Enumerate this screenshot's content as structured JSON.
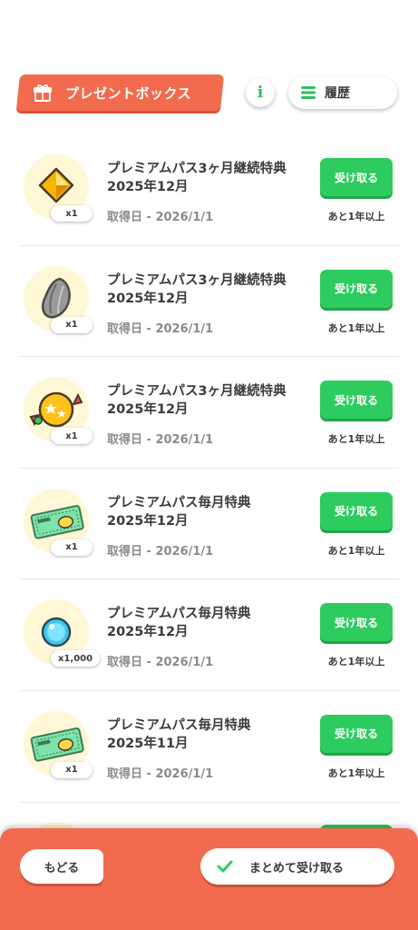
{
  "header": {
    "title": "プレゼントボックス",
    "info_label": "i",
    "history_label": "履歴"
  },
  "items": [
    {
      "icon": "yellow-diamond-icon",
      "qty": "x1",
      "name": "プレミアムパス3ヶ月継続特典\n2025年12月",
      "date": "取得日 - 2026/1/1",
      "button": "受け取る",
      "remaining": "あと1年以上"
    },
    {
      "icon": "sunflower-seed-icon",
      "qty": "x1",
      "name": "プレミアムパス3ヶ月継続特典\n2025年12月",
      "date": "取得日 - 2026/1/1",
      "button": "受け取る",
      "remaining": "あと1年以上"
    },
    {
      "icon": "star-candy-icon",
      "qty": "x1",
      "name": "プレミアムパス3ヶ月継続特典\n2025年12月",
      "date": "取得日 - 2026/1/1",
      "button": "受け取る",
      "remaining": "あと1年以上"
    },
    {
      "icon": "ticket-icon",
      "qty": "x1",
      "name": "プレミアムパス毎月特典\n2025年12月",
      "date": "取得日 - 2026/1/1",
      "button": "受け取る",
      "remaining": "あと1年以上"
    },
    {
      "icon": "blue-orb-icon",
      "qty": "x1,000",
      "name": "プレミアムパス毎月特典\n2025年12月",
      "date": "取得日 - 2026/1/1",
      "button": "受け取る",
      "remaining": "あと1年以上"
    },
    {
      "icon": "ticket-icon",
      "qty": "x1",
      "name": "プレミアムパス毎月特典\n2025年11月",
      "date": "取得日 - 2026/1/1",
      "button": "受け取る",
      "remaining": "あと1年以上"
    }
  ],
  "footer": {
    "back_label": "もどる",
    "bulk_receive_label": "まとめて受け取る"
  },
  "colors": {
    "accent": "#f26b4e",
    "receive_green": "#2ecb5f",
    "icon_bg": "#fff7d6"
  }
}
